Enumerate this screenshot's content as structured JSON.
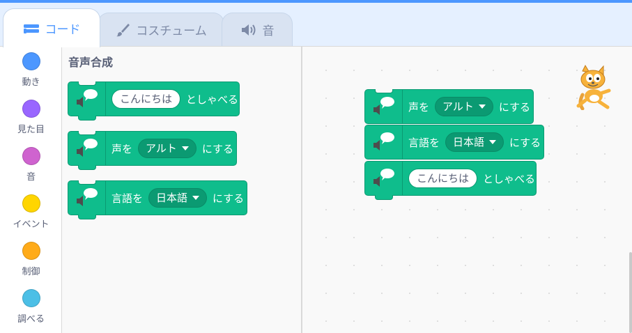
{
  "tabs": [
    {
      "label": "コード",
      "icon": "code-icon",
      "active": true
    },
    {
      "label": "コスチューム",
      "icon": "brush-icon",
      "active": false
    },
    {
      "label": "音",
      "icon": "speaker-icon",
      "active": false
    }
  ],
  "categories": [
    {
      "label": "動き",
      "color": "#4c97ff"
    },
    {
      "label": "見た目",
      "color": "#9966ff"
    },
    {
      "label": "音",
      "color": "#cf63cf"
    },
    {
      "label": "イベント",
      "color": "#ffd500"
    },
    {
      "label": "制御",
      "color": "#ffab19"
    },
    {
      "label": "調べる",
      "color": "#4cbfe6"
    }
  ],
  "palette": {
    "title": "音声合成",
    "blocks": {
      "speak": {
        "input": "こんにちは",
        "suffix": "としゃべる"
      },
      "voice": {
        "prefix": "声を",
        "dropdown": "アルト",
        "suffix": "にする"
      },
      "language": {
        "prefix": "言語を",
        "dropdown": "日本語",
        "suffix": "にする"
      }
    }
  },
  "workspace": {
    "blocks": {
      "voice": {
        "prefix": "声を",
        "dropdown": "アルト",
        "suffix": "にする"
      },
      "language": {
        "prefix": "言語を",
        "dropdown": "日本語",
        "suffix": "にする"
      },
      "speak": {
        "input": "こんにちは",
        "suffix": "としゃべる"
      }
    }
  },
  "colors": {
    "accent": "#4c97ff",
    "extension_block": "#0fbd8c",
    "extension_block_border": "#0b9a72"
  }
}
